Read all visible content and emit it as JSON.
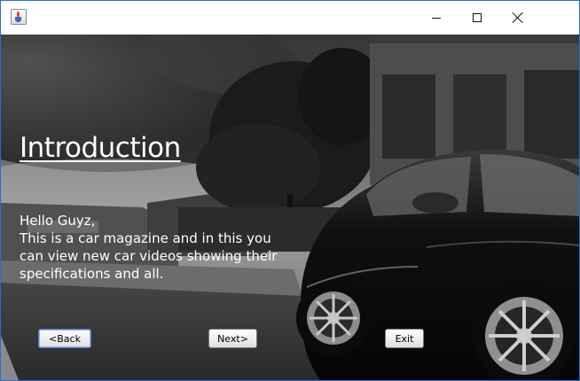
{
  "window": {
    "title": "",
    "controls": {
      "minimize": "minimize",
      "maximize": "maximize",
      "close": "close"
    }
  },
  "intro": {
    "heading": "Introduction",
    "lines": [
      "Hello Guyz,",
      "This is a car magazine and in this you",
      "can view new car videos showing their",
      "specifications and all."
    ]
  },
  "buttons": {
    "back": "<Back",
    "next": "Next>",
    "exit": "Exit"
  },
  "icons": {
    "app": "java-cup-icon",
    "minimize": "minimize-icon",
    "maximize": "maximize-icon",
    "close": "close-icon"
  }
}
